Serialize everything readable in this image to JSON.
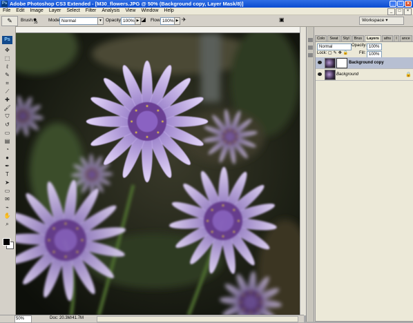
{
  "window": {
    "title": "Adobe Photoshop CS3 Extended - [M30_flowers.JPG @ 50% (Background copy, Layer Mask/8)]",
    "app_icon": "Ps",
    "buttons": [
      "_",
      "□",
      "×"
    ]
  },
  "menu": [
    "File",
    "Edit",
    "Image",
    "Layer",
    "Select",
    "Filter",
    "Analysis",
    "View",
    "Window",
    "Help"
  ],
  "mdi_buttons": [
    "_",
    "□",
    "×"
  ],
  "options": {
    "brush_label": "Brush:",
    "brush_size": "35",
    "mode_label": "Mode:",
    "mode_value": "Normal",
    "opacity_label": "Opacity:",
    "opacity_value": "100%",
    "flow_label": "Flow:",
    "flow_value": "100%",
    "workspace_label": "Workspace ▾"
  },
  "toolbox": {
    "logo": "Ps",
    "tools": [
      "move-tool",
      "marquee-tool",
      "lasso-tool",
      "quick-select-tool",
      "crop-tool",
      "slice-tool",
      "healing-tool",
      "brush-tool",
      "clone-stamp-tool",
      "history-brush-tool",
      "eraser-tool",
      "gradient-tool",
      "blur-tool",
      "dodge-tool",
      "pen-tool",
      "type-tool",
      "path-select-tool",
      "shape-tool",
      "notes-tool",
      "eyedropper-tool",
      "hand-tool",
      "zoom-tool"
    ],
    "foreground_color": "#000000",
    "background_color": "#ffffff"
  },
  "status": {
    "zoom": "50%",
    "doc_size": "Doc: 20.3M/41.7M"
  },
  "panel": {
    "tabs": [
      "Colo",
      "Swat",
      "Styl",
      "Brus",
      "Layers",
      "aths",
      "I",
      "ance"
    ],
    "active_tab": "Layers",
    "blend_mode": "Normal",
    "opacity_label": "Opacity:",
    "opacity_value": "100%",
    "lock_label": "Lock:",
    "fill_label": "Fill:",
    "fill_value": "100%",
    "layers": [
      {
        "name": "Background copy",
        "selected": true,
        "has_mask": true
      },
      {
        "name": "Background",
        "selected": false,
        "has_mask": false,
        "locked": true
      }
    ]
  },
  "colors": {
    "title_bar": "#0a4bd0",
    "chrome": "#d4d0c8",
    "flower_petal": "#c9b4ee",
    "flower_center": "#6a3f94"
  }
}
